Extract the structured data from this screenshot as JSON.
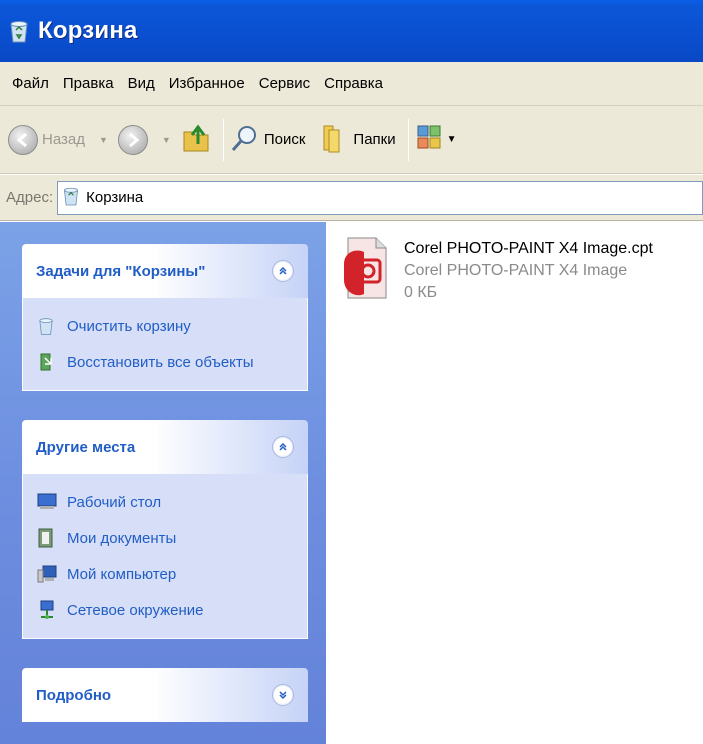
{
  "window": {
    "title": "Корзина",
    "icon": "recycle-bin-icon"
  },
  "menu": {
    "items": [
      "Файл",
      "Правка",
      "Вид",
      "Избранное",
      "Сервис",
      "Справка"
    ]
  },
  "toolbar": {
    "back_label": "Назад",
    "search_label": "Поиск",
    "folders_label": "Папки"
  },
  "address": {
    "label": "Адрес:",
    "value": "Корзина"
  },
  "tasks_panel": {
    "title": "Задачи для \"Корзины\"",
    "items": [
      {
        "label": "Очистить корзину",
        "icon": "empty-bin-icon"
      },
      {
        "label": "Восстановить все объекты",
        "icon": "restore-icon"
      }
    ]
  },
  "places_panel": {
    "title": "Другие места",
    "items": [
      {
        "label": "Рабочий стол",
        "icon": "desktop-icon"
      },
      {
        "label": "Мои документы",
        "icon": "documents-icon"
      },
      {
        "label": "Мой компьютер",
        "icon": "computer-icon"
      },
      {
        "label": "Сетевое окружение",
        "icon": "network-icon"
      }
    ]
  },
  "details_panel": {
    "title": "Подробно"
  },
  "files": [
    {
      "name": "Corel PHOTO-PAINT X4 Image.cpt",
      "type": "Corel PHOTO-PAINT X4 Image",
      "size": "0 КБ",
      "icon": "corel-photo-paint-file-icon"
    }
  ],
  "colors": {
    "titlebar": "#0a4fd0",
    "chrome": "#ece9d8",
    "taskpane": "#6e8fe0",
    "link": "#215dc6"
  }
}
